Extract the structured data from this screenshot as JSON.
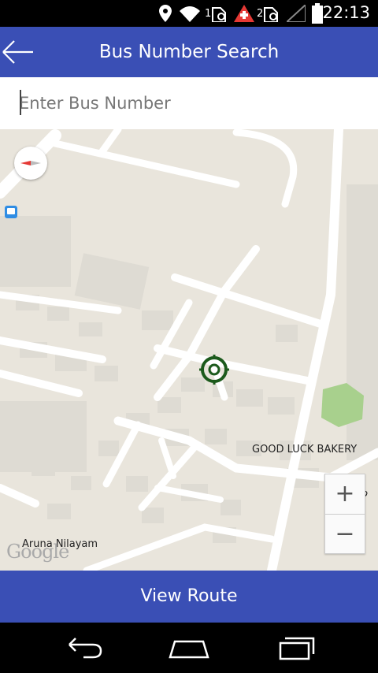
{
  "status": {
    "time": "22:13",
    "sim1": "1",
    "sim2": "2",
    "icons": [
      "location-icon",
      "wifi-icon",
      "sim1-icon",
      "alert-icon",
      "sim2-icon",
      "signal-icon",
      "battery-icon"
    ]
  },
  "appbar": {
    "title": "Bus Number Search",
    "back_icon": "back-arrow-icon"
  },
  "search": {
    "placeholder": "Enter Bus Number",
    "value": ""
  },
  "map": {
    "labels": {
      "bakery": "GOOD LUCK BAKERY",
      "place": "Aruna Nilayam",
      "road": "HP Ro"
    },
    "attribution": "Google",
    "zoom_in": "+",
    "zoom_out": "−",
    "colors": {
      "land": "#e9e5dc",
      "road": "#ffffff",
      "building": "#dedbd3",
      "park": "#a8d08d",
      "marker": "#1c5a1c"
    }
  },
  "bottom": {
    "button_label": "View Route"
  },
  "colors": {
    "primary": "#3a4fb5"
  }
}
